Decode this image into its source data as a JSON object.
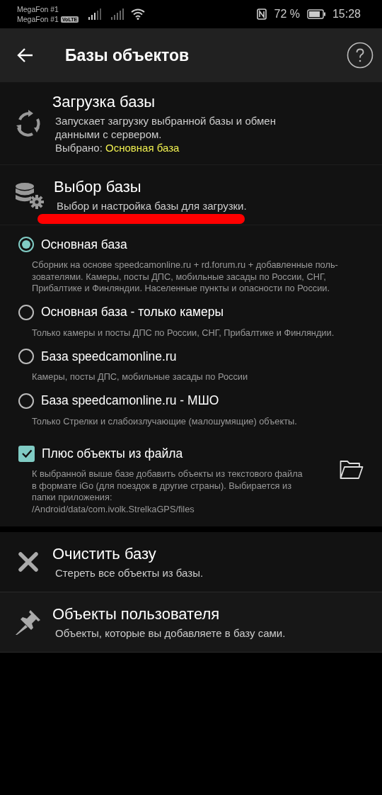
{
  "status_bar": {
    "carrier_1": "MegaFon #1",
    "carrier_2": "MegaFon #1",
    "volte": "VoLTE",
    "battery_percent": "72 %",
    "time": "15:28"
  },
  "app_bar": {
    "title": "Базы объектов"
  },
  "load_section": {
    "title": "Загрузка базы",
    "description": "Запускает загрузку выбранной базы и обмен данными с сервером.",
    "selected_label": "Выбрано:",
    "selected_value": "Основная база"
  },
  "choose_section": {
    "title": "Выбор базы",
    "description": "Выбор и настройка базы для загрузки.",
    "underlined": true
  },
  "bases": [
    {
      "label": "Основная база",
      "selected": true,
      "lines": [
        "Сборник на основе speedcamonline.ru + rd.forum.ru + добавленные поль-",
        "зователями. Камеры, посты ДПС, мобильные засады по России, СНГ,",
        "Прибалтике и Финляндии. Населенные пункты и опасности по России."
      ]
    },
    {
      "label": "Основная база - только камеры",
      "selected": false,
      "lines": [
        "Только камеры и посты ДПС по России, СНГ, Прибалтике и Финляндии."
      ]
    },
    {
      "label": "База speedcamonline.ru",
      "selected": false,
      "lines": [
        "Камеры, посты ДПС, мобильные засады по России"
      ]
    },
    {
      "label": "База speedcamonline.ru - МШО",
      "selected": false,
      "lines": [
        "Только Стрелки и слабоизлучающие (малошумящие) объекты."
      ]
    }
  ],
  "file_option": {
    "label": "Плюс объекты из файла",
    "checked": true,
    "lines": [
      "К выбранной выше базе добавить объекты из текстового файла",
      "в формате iGo (для поездок в другие страны). Выбирается из",
      "папки приложения:",
      "/Android/data/com.ivolk.StrelkaGPS/files"
    ]
  },
  "clear_section": {
    "title": "Очистить базу",
    "description": "Стереть все объекты из базы."
  },
  "user_section": {
    "title": "Объекты пользователя",
    "description": "Объекты, которые вы добавляете в базу сами."
  }
}
